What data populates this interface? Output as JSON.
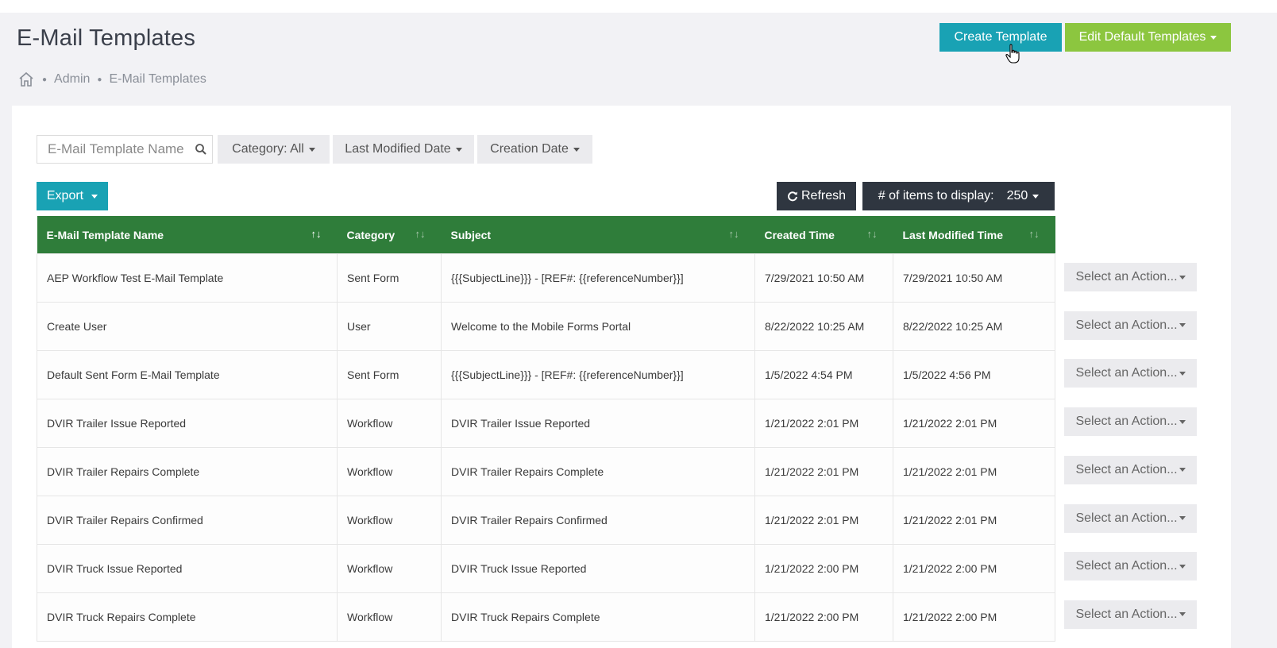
{
  "header": {
    "title": "E-Mail Templates",
    "create_button": "Create Template",
    "edit_default_button": "Edit Default Templates"
  },
  "breadcrumb": {
    "items": [
      "Admin",
      "E-Mail Templates"
    ]
  },
  "filters": {
    "search_placeholder": "E-Mail Template Name",
    "category": "Category: All",
    "last_modified": "Last Modified Date",
    "creation_date": "Creation Date"
  },
  "toolbar": {
    "export": "Export",
    "refresh": "Refresh",
    "items_label": "# of items to display:",
    "items_value": "250"
  },
  "table": {
    "columns": [
      "E-Mail Template Name",
      "Category",
      "Subject",
      "Created Time",
      "Last Modified Time"
    ],
    "rows": [
      {
        "name": "AEP Workflow Test E-Mail Template",
        "category": "Sent Form",
        "subject": "{{{SubjectLine}}} - [REF#: {{referenceNumber}}]",
        "created": "7/29/2021 10:50 AM",
        "modified": "7/29/2021 10:50 AM"
      },
      {
        "name": "Create User",
        "category": "User",
        "subject": "Welcome to the Mobile Forms Portal",
        "created": "8/22/2022 10:25 AM",
        "modified": "8/22/2022 10:25 AM"
      },
      {
        "name": "Default Sent Form E-Mail Template",
        "category": "Sent Form",
        "subject": "{{{SubjectLine}}} - [REF#: {{referenceNumber}}]",
        "created": "1/5/2022 4:54 PM",
        "modified": "1/5/2022 4:56 PM"
      },
      {
        "name": "DVIR Trailer Issue Reported",
        "category": "Workflow",
        "subject": "DVIR Trailer Issue Reported",
        "created": "1/21/2022 2:01 PM",
        "modified": "1/21/2022 2:01 PM"
      },
      {
        "name": "DVIR Trailer Repairs Complete",
        "category": "Workflow",
        "subject": "DVIR Trailer Repairs Complete",
        "created": "1/21/2022 2:01 PM",
        "modified": "1/21/2022 2:01 PM"
      },
      {
        "name": "DVIR Trailer Repairs Confirmed",
        "category": "Workflow",
        "subject": "DVIR Trailer Repairs Confirmed",
        "created": "1/21/2022 2:01 PM",
        "modified": "1/21/2022 2:01 PM"
      },
      {
        "name": "DVIR Truck Issue Reported",
        "category": "Workflow",
        "subject": "DVIR Truck Issue Reported",
        "created": "1/21/2022 2:00 PM",
        "modified": "1/21/2022 2:00 PM"
      },
      {
        "name": "DVIR Truck Repairs Complete",
        "category": "Workflow",
        "subject": "DVIR Truck Repairs Complete",
        "created": "1/21/2022 2:00 PM",
        "modified": "1/21/2022 2:00 PM"
      }
    ],
    "row_action": "Select an Action..."
  },
  "colors": {
    "accent_teal": "#19a2b4",
    "accent_green": "#8cc63f",
    "header_green": "#2f7d3a",
    "dark_button": "#2f3640"
  }
}
